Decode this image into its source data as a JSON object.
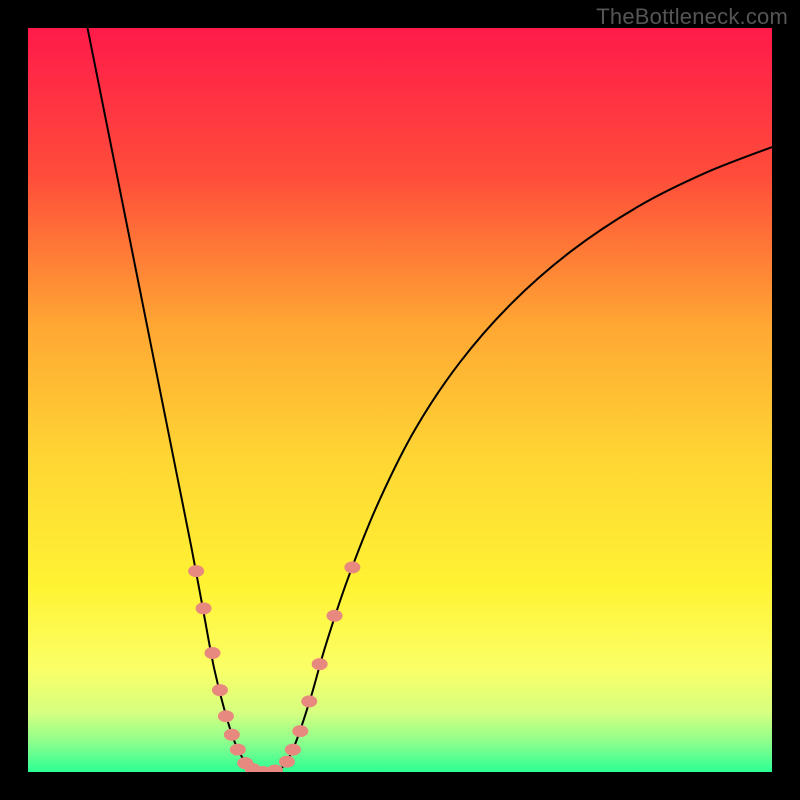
{
  "watermark": "TheBottleneck.com",
  "chart_data": {
    "type": "line",
    "title": "",
    "xlabel": "",
    "ylabel": "",
    "xlim": [
      0,
      100
    ],
    "ylim": [
      0,
      100
    ],
    "grid": false,
    "legend": false,
    "background_gradient": {
      "stops": [
        {
          "pos": 0.0,
          "color": "#ff1a4a"
        },
        {
          "pos": 0.2,
          "color": "#ff4d3a"
        },
        {
          "pos": 0.4,
          "color": "#ffa733"
        },
        {
          "pos": 0.58,
          "color": "#ffd633"
        },
        {
          "pos": 0.75,
          "color": "#fff333"
        },
        {
          "pos": 0.86,
          "color": "#fbff66"
        },
        {
          "pos": 0.92,
          "color": "#d6ff80"
        },
        {
          "pos": 0.96,
          "color": "#8cff8c"
        },
        {
          "pos": 1.0,
          "color": "#2bff94"
        }
      ]
    },
    "series": [
      {
        "name": "bottleneck-curve",
        "color": "#000000",
        "stroke_width": 2,
        "points": [
          {
            "x": 8.0,
            "y": 100.0
          },
          {
            "x": 10.0,
            "y": 90.0
          },
          {
            "x": 12.0,
            "y": 80.0
          },
          {
            "x": 14.0,
            "y": 70.0
          },
          {
            "x": 16.0,
            "y": 60.0
          },
          {
            "x": 18.0,
            "y": 50.0
          },
          {
            "x": 20.0,
            "y": 40.0
          },
          {
            "x": 22.0,
            "y": 30.0
          },
          {
            "x": 23.5,
            "y": 22.0
          },
          {
            "x": 25.0,
            "y": 14.0
          },
          {
            "x": 26.5,
            "y": 8.0
          },
          {
            "x": 28.0,
            "y": 3.5
          },
          {
            "x": 29.5,
            "y": 1.0
          },
          {
            "x": 31.0,
            "y": 0.0
          },
          {
            "x": 33.0,
            "y": 0.0
          },
          {
            "x": 34.5,
            "y": 1.0
          },
          {
            "x": 36.0,
            "y": 4.0
          },
          {
            "x": 38.0,
            "y": 10.0
          },
          {
            "x": 40.0,
            "y": 17.0
          },
          {
            "x": 43.0,
            "y": 26.0
          },
          {
            "x": 47.0,
            "y": 36.0
          },
          {
            "x": 52.0,
            "y": 46.0
          },
          {
            "x": 58.0,
            "y": 55.0
          },
          {
            "x": 65.0,
            "y": 63.0
          },
          {
            "x": 73.0,
            "y": 70.0
          },
          {
            "x": 82.0,
            "y": 76.0
          },
          {
            "x": 91.0,
            "y": 80.5
          },
          {
            "x": 100.0,
            "y": 84.0
          }
        ]
      }
    ],
    "markers": {
      "color": "#e8897f",
      "rx": 8,
      "ry": 6,
      "points": [
        {
          "x": 22.6,
          "y": 27.0
        },
        {
          "x": 23.6,
          "y": 22.0
        },
        {
          "x": 24.8,
          "y": 16.0
        },
        {
          "x": 25.8,
          "y": 11.0
        },
        {
          "x": 26.6,
          "y": 7.5
        },
        {
          "x": 27.4,
          "y": 5.0
        },
        {
          "x": 28.2,
          "y": 3.0
        },
        {
          "x": 29.2,
          "y": 1.2
        },
        {
          "x": 30.2,
          "y": 0.4
        },
        {
          "x": 31.6,
          "y": 0.0
        },
        {
          "x": 33.2,
          "y": 0.2
        },
        {
          "x": 34.8,
          "y": 1.4
        },
        {
          "x": 35.6,
          "y": 3.0
        },
        {
          "x": 36.6,
          "y": 5.5
        },
        {
          "x": 37.8,
          "y": 9.5
        },
        {
          "x": 39.2,
          "y": 14.5
        },
        {
          "x": 41.2,
          "y": 21.0
        },
        {
          "x": 43.6,
          "y": 27.5
        }
      ]
    }
  }
}
